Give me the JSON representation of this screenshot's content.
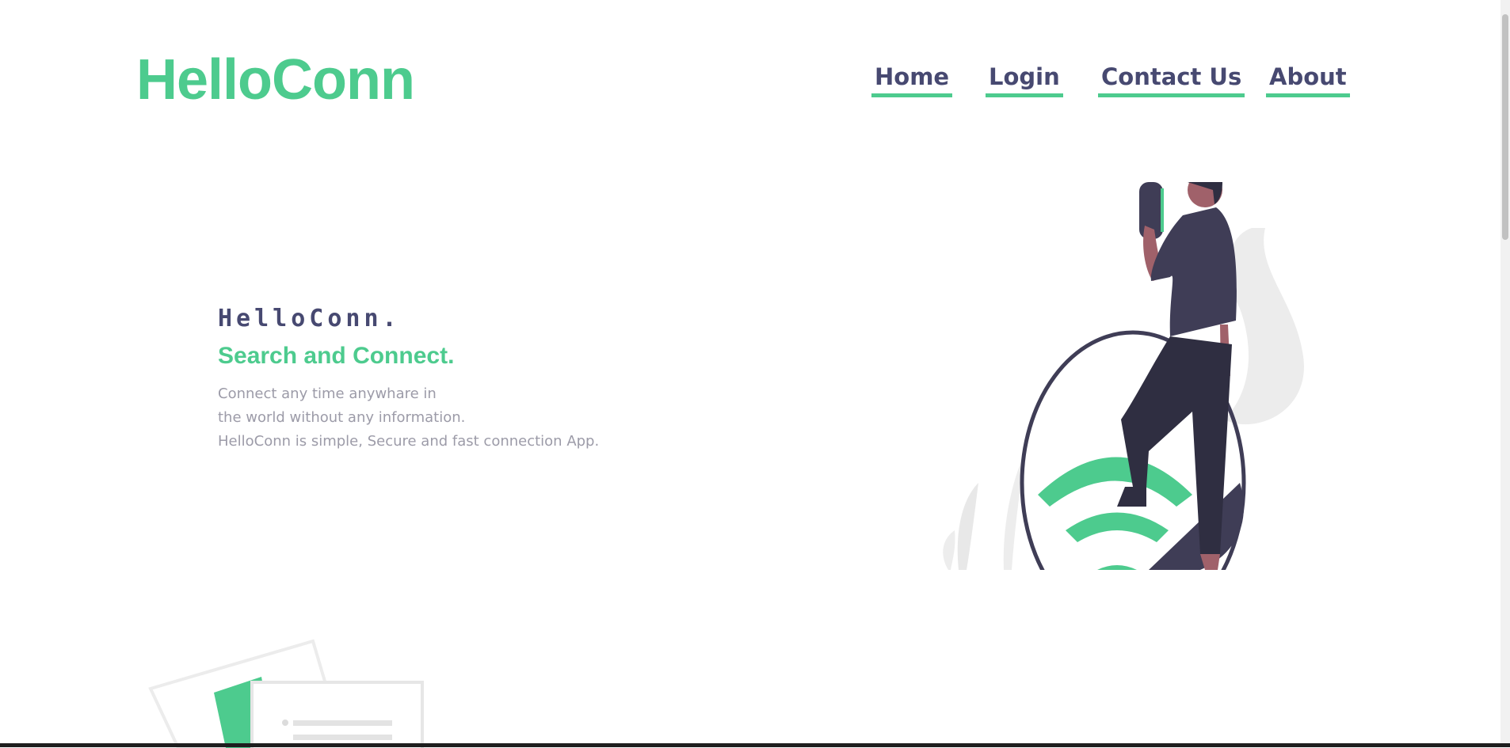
{
  "header": {
    "logo": "HelloConn",
    "nav": [
      {
        "label": "Home"
      },
      {
        "label": "Login"
      },
      {
        "label": "Contact Us"
      },
      {
        "label": "About"
      }
    ]
  },
  "hero": {
    "kicker": "HelloConn.",
    "title": "Search and Connect.",
    "description_lines": [
      "Connect any time anywhare in",
      "the world without any information.",
      "HelloConn is simple, Secure and fast connection App."
    ]
  },
  "colors": {
    "brand_green": "#4dcb8e",
    "nav_text": "#474971",
    "muted_text": "#9c9ba8"
  },
  "icons": [
    "wifi-person-illustration",
    "documents-illustration"
  ]
}
